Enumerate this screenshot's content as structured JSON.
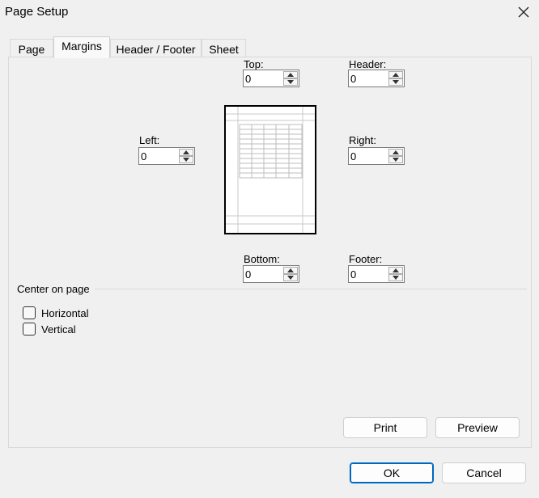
{
  "window": {
    "title": "Page Setup"
  },
  "tabs": [
    {
      "label": "Page",
      "active": false
    },
    {
      "label": "Margins",
      "active": true
    },
    {
      "label": "Header / Footer",
      "active": false
    },
    {
      "label": "Sheet",
      "active": false
    }
  ],
  "margins": {
    "top": {
      "label": "Top:",
      "value": "0"
    },
    "header": {
      "label": "Header:",
      "value": "0"
    },
    "left": {
      "label": "Left:",
      "value": "0"
    },
    "right": {
      "label": "Right:",
      "value": "0"
    },
    "bottom": {
      "label": "Bottom:",
      "value": "0"
    },
    "footer": {
      "label": "Footer:",
      "value": "0"
    }
  },
  "center_on_page": {
    "label": "Center on page",
    "horizontal": {
      "label": "Horizontal",
      "checked": false
    },
    "vertical": {
      "label": "Vertical",
      "checked": false
    }
  },
  "buttons": {
    "print": "Print",
    "preview": "Preview",
    "ok": "OK",
    "cancel": "Cancel"
  },
  "colors": {
    "accent": "#0067c0",
    "background": "#f0f0f0"
  }
}
